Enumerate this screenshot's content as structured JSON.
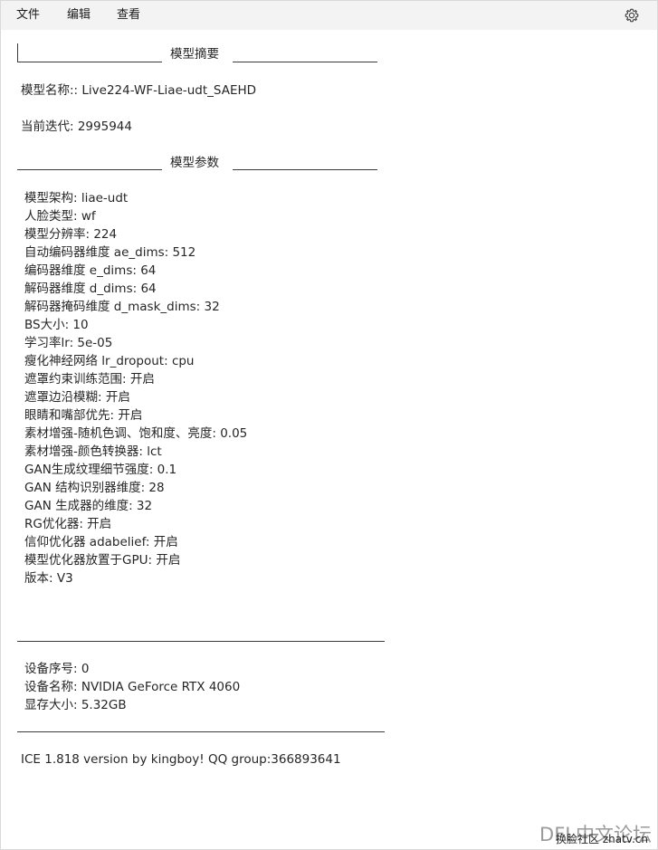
{
  "menu": {
    "file": "文件",
    "edit": "编辑",
    "view": "查看"
  },
  "icons": {
    "settings": "gear-icon"
  },
  "summary": {
    "title": "模型摘要",
    "model_name": "模型名称:: Live224-WF-Liae-udt_SAEHD",
    "iteration": "当前迭代: 2995944"
  },
  "params": {
    "title": "模型参数",
    "rows": [
      "模型架构: liae-udt",
      "人脸类型: wf",
      "模型分辨率: 224",
      "自动编码器维度 ae_dims: 512",
      "编码器维度 e_dims: 64",
      "解码器维度 d_dims: 64",
      "解码器掩码维度 d_mask_dims: 32",
      "BS大小: 10",
      "学习率lr: 5e-05",
      "瘦化神经网络 lr_dropout: cpu",
      "遮罩约束训练范围: 开启",
      "遮罩边沿模糊: 开启",
      "眼睛和嘴部优先: 开启",
      "素材增强-随机色调、饱和度、亮度: 0.05",
      "素材增强-颜色转换器: lct",
      "GAN生成纹理细节强度: 0.1",
      "GAN 结构识别器维度: 28",
      "GAN 生成器的维度: 32",
      "RG优化器: 开启",
      "信仰优化器 adabelief: 开启",
      "模型优化器放置于GPU: 开启",
      "版本: V3"
    ]
  },
  "device": {
    "index": "设备序号: 0",
    "name": "设备名称: NVIDIA GeForce RTX 4060",
    "vram": "显存大小: 5.32GB"
  },
  "footer": {
    "credit": "ICE 1.818 version by kingboy! QQ group:366893641"
  },
  "watermark": {
    "main": "DFL中文论坛",
    "sub": "换脸社区 zhatv.cn"
  }
}
